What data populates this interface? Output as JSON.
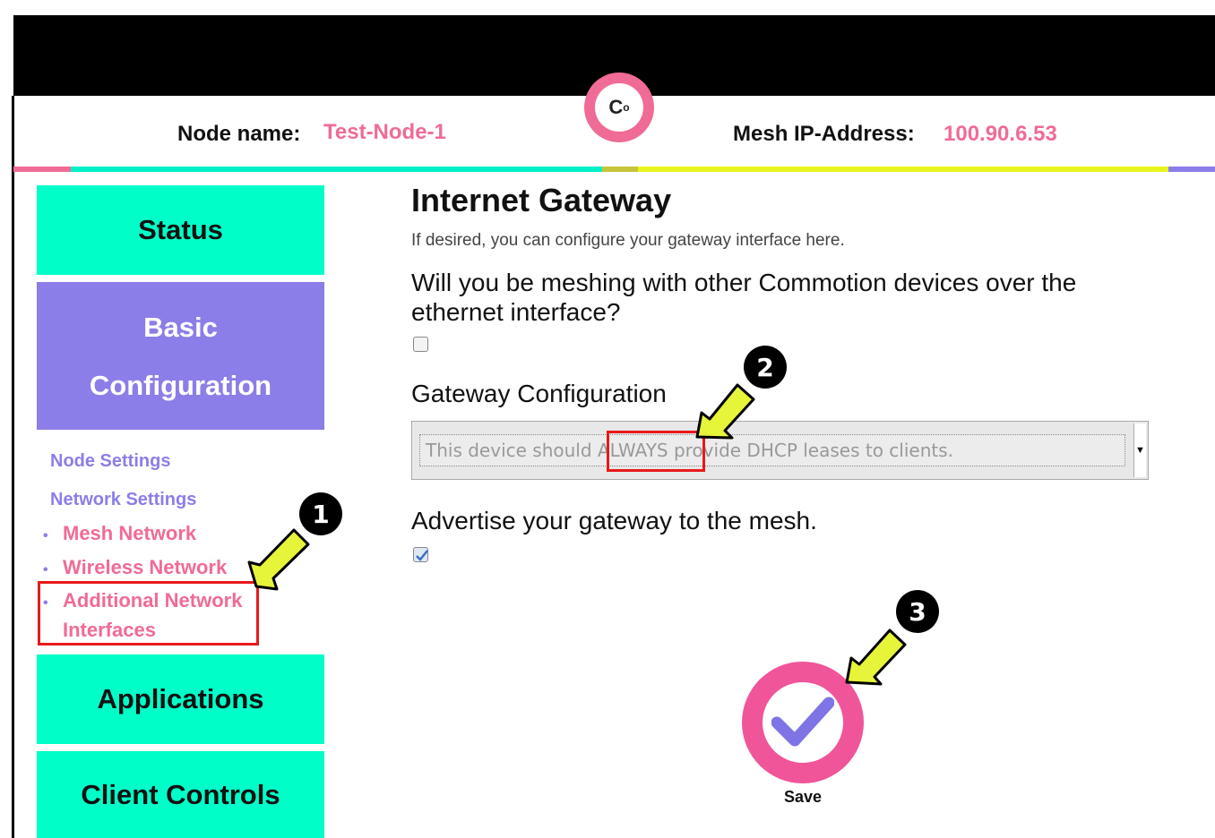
{
  "header": {
    "node_name_label": "Node name:",
    "node_name_value": "Test-Node-1",
    "mesh_ip_label": "Mesh IP-Address:",
    "mesh_ip_value": "100.90.6.53",
    "logo_text": "C",
    "logo_sup": "o"
  },
  "sidebar": {
    "status": "Status",
    "basic_config_line1": "Basic",
    "basic_config_line2": "Configuration",
    "node_settings": "Node Settings",
    "network_settings": "Network Settings",
    "items": [
      {
        "label": "Mesh Network"
      },
      {
        "label": "Wireless Network"
      },
      {
        "label": "Additional Network",
        "label2": "Interfaces"
      }
    ],
    "bullet": "•",
    "applications": "Applications",
    "client_controls": "Client Controls"
  },
  "main": {
    "title": "Internet Gateway",
    "description": "If desired, you can configure your gateway interface here.",
    "mesh_question": "Will you be meshing with other Commotion devices over the ethernet interface?",
    "mesh_checked": false,
    "gateway_label": "Gateway Configuration",
    "gateway_selected": "This device should ALWAYS provide DHCP leases to clients.",
    "advertise_label": "Advertise your gateway to the mesh.",
    "advertise_checked": true,
    "save_label": "Save"
  },
  "annotations": {
    "badges": [
      "1",
      "2",
      "3"
    ],
    "highlight_color": "#e8191b",
    "arrow_color": "#e6f53a"
  },
  "colors": {
    "teal": "#00ffc8",
    "purple": "#8b7ee8",
    "pink": "#f06b95",
    "yellow": "#e6f53a"
  }
}
